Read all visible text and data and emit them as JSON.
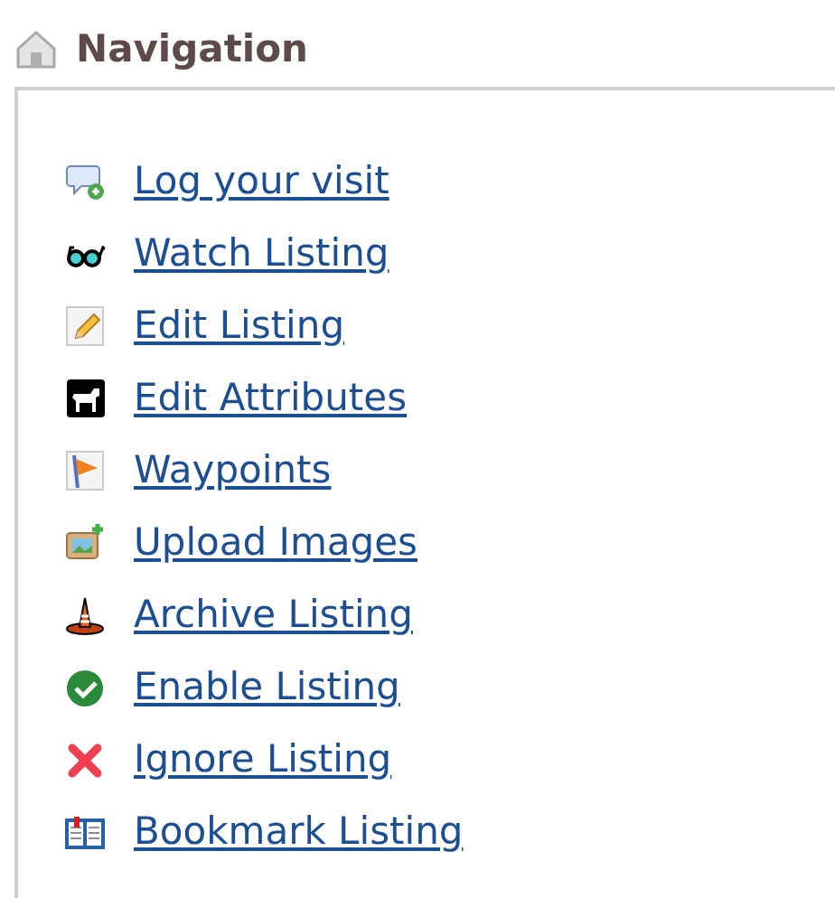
{
  "heading": "Navigation",
  "links": [
    {
      "kind": "log",
      "label": "Log your visit"
    },
    {
      "kind": "watch",
      "label": "Watch Listing"
    },
    {
      "kind": "edit",
      "label": "Edit Listing"
    },
    {
      "kind": "attributes",
      "label": "Edit Attributes"
    },
    {
      "kind": "waypoints",
      "label": "Waypoints"
    },
    {
      "kind": "upload",
      "label": "Upload Images"
    },
    {
      "kind": "archive",
      "label": "Archive Listing"
    },
    {
      "kind": "enable",
      "label": "Enable Listing"
    },
    {
      "kind": "ignore",
      "label": "Ignore Listing"
    },
    {
      "kind": "bookmark",
      "label": "Bookmark Listing"
    }
  ]
}
